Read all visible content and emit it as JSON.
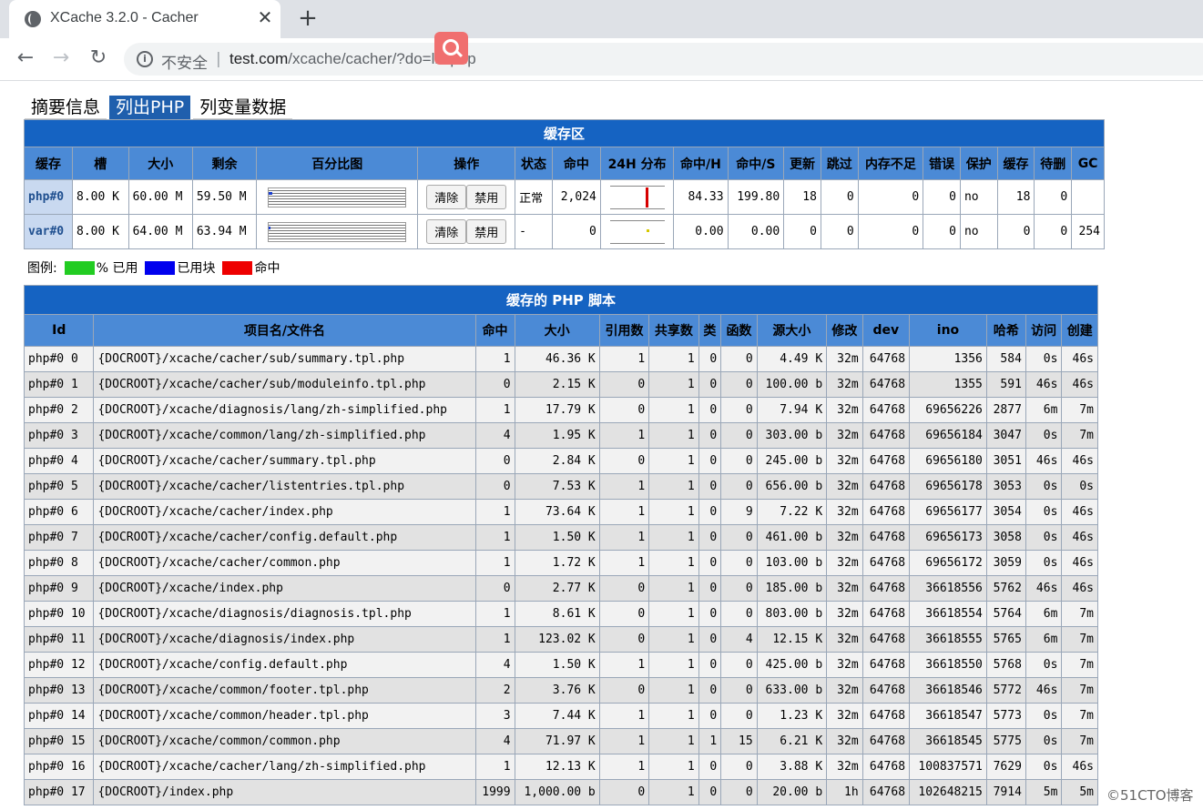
{
  "browser": {
    "tab_title": "XCache 3.2.0 - Cacher",
    "tab_close": "✕",
    "new_tab": "+",
    "insecure_label": "不安全",
    "separator": "|",
    "url_host": "test.com",
    "url_path": "/xcache/cacher/?do=listphp",
    "nav": {
      "back": "←",
      "forward": "→",
      "reload": "↻"
    }
  },
  "page_tabs": [
    "摘要信息",
    "列出PHP",
    "列变量数据"
  ],
  "cache_section": {
    "title": "缓存区",
    "headers": [
      "缓存",
      "槽",
      "大小",
      "剩余",
      "百分比图",
      "操作",
      "状态",
      "命中",
      "24H 分布",
      "命中/H",
      "命中/S",
      "更新",
      "跳过",
      "内存不足",
      "错误",
      "保护",
      "缓存",
      "待删",
      "GC"
    ],
    "clear_label": "清除",
    "disable_label": "禁用",
    "rows": [
      {
        "name": "php#0",
        "slots": "8.00 K",
        "size": "60.00 M",
        "avail": "59.50 M",
        "used_pct": 0.8,
        "status": "正常",
        "hits": "2,024",
        "hits_h": "84.33",
        "hits_s": "199.80",
        "updates": "18",
        "skips": "0",
        "ooms": "0",
        "errors": "0",
        "protected": "no",
        "cached": "18",
        "deleted": "0",
        "gc": ""
      },
      {
        "name": "var#0",
        "slots": "8.00 K",
        "size": "64.00 M",
        "avail": "63.94 M",
        "used_pct": 0.1,
        "status": "-",
        "hits": "0",
        "hits_h": "0.00",
        "hits_s": "0.00",
        "updates": "0",
        "skips": "0",
        "ooms": "0",
        "errors": "0",
        "protected": "no",
        "cached": "0",
        "deleted": "0",
        "gc": "254"
      }
    ]
  },
  "legend": {
    "label": "图例:",
    "items": [
      {
        "text": "% 已用",
        "color": "#22cc22"
      },
      {
        "text": "已用块",
        "color": "#0000ee"
      },
      {
        "text": "命中",
        "color": "#ee0000"
      }
    ]
  },
  "scripts_section": {
    "title": "缓存的 PHP 脚本",
    "headers": [
      "Id",
      "项目名/文件名",
      "命中",
      "大小",
      "引用数",
      "共享数",
      "类",
      "函数",
      "源大小",
      "修改",
      "dev",
      "ino",
      "哈希",
      "访问",
      "创建"
    ],
    "rows": [
      [
        "php#0 0",
        "{DOCROOT}/xcache/cacher/sub/summary.tpl.php",
        "1",
        "46.36 K",
        "1",
        "1",
        "0",
        "0",
        "4.49 K",
        "32m",
        "64768",
        "1356",
        "584",
        "0s",
        "46s"
      ],
      [
        "php#0 1",
        "{DOCROOT}/xcache/cacher/sub/moduleinfo.tpl.php",
        "0",
        "2.15 K",
        "0",
        "1",
        "0",
        "0",
        "100.00 b",
        "32m",
        "64768",
        "1355",
        "591",
        "46s",
        "46s"
      ],
      [
        "php#0 2",
        "{DOCROOT}/xcache/diagnosis/lang/zh-simplified.php",
        "1",
        "17.79 K",
        "0",
        "1",
        "0",
        "0",
        "7.94 K",
        "32m",
        "64768",
        "69656226",
        "2877",
        "6m",
        "7m"
      ],
      [
        "php#0 3",
        "{DOCROOT}/xcache/common/lang/zh-simplified.php",
        "4",
        "1.95 K",
        "1",
        "1",
        "0",
        "0",
        "303.00 b",
        "32m",
        "64768",
        "69656184",
        "3047",
        "0s",
        "7m"
      ],
      [
        "php#0 4",
        "{DOCROOT}/xcache/cacher/summary.tpl.php",
        "0",
        "2.84 K",
        "0",
        "1",
        "0",
        "0",
        "245.00 b",
        "32m",
        "64768",
        "69656180",
        "3051",
        "46s",
        "46s"
      ],
      [
        "php#0 5",
        "{DOCROOT}/xcache/cacher/listentries.tpl.php",
        "0",
        "7.53 K",
        "1",
        "1",
        "0",
        "0",
        "656.00 b",
        "32m",
        "64768",
        "69656178",
        "3053",
        "0s",
        "0s"
      ],
      [
        "php#0 6",
        "{DOCROOT}/xcache/cacher/index.php",
        "1",
        "73.64 K",
        "1",
        "1",
        "0",
        "9",
        "7.22 K",
        "32m",
        "64768",
        "69656177",
        "3054",
        "0s",
        "46s"
      ],
      [
        "php#0 7",
        "{DOCROOT}/xcache/cacher/config.default.php",
        "1",
        "1.50 K",
        "1",
        "1",
        "0",
        "0",
        "461.00 b",
        "32m",
        "64768",
        "69656173",
        "3058",
        "0s",
        "46s"
      ],
      [
        "php#0 8",
        "{DOCROOT}/xcache/cacher/common.php",
        "1",
        "1.72 K",
        "1",
        "1",
        "0",
        "0",
        "103.00 b",
        "32m",
        "64768",
        "69656172",
        "3059",
        "0s",
        "46s"
      ],
      [
        "php#0 9",
        "{DOCROOT}/xcache/index.php",
        "0",
        "2.77 K",
        "0",
        "1",
        "0",
        "0",
        "185.00 b",
        "32m",
        "64768",
        "36618556",
        "5762",
        "46s",
        "46s"
      ],
      [
        "php#0 10",
        "{DOCROOT}/xcache/diagnosis/diagnosis.tpl.php",
        "1",
        "8.61 K",
        "0",
        "1",
        "0",
        "0",
        "803.00 b",
        "32m",
        "64768",
        "36618554",
        "5764",
        "6m",
        "7m"
      ],
      [
        "php#0 11",
        "{DOCROOT}/xcache/diagnosis/index.php",
        "1",
        "123.02 K",
        "0",
        "1",
        "0",
        "4",
        "12.15 K",
        "32m",
        "64768",
        "36618555",
        "5765",
        "6m",
        "7m"
      ],
      [
        "php#0 12",
        "{DOCROOT}/xcache/config.default.php",
        "4",
        "1.50 K",
        "1",
        "1",
        "0",
        "0",
        "425.00 b",
        "32m",
        "64768",
        "36618550",
        "5768",
        "0s",
        "7m"
      ],
      [
        "php#0 13",
        "{DOCROOT}/xcache/common/footer.tpl.php",
        "2",
        "3.76 K",
        "0",
        "1",
        "0",
        "0",
        "633.00 b",
        "32m",
        "64768",
        "36618546",
        "5772",
        "46s",
        "7m"
      ],
      [
        "php#0 14",
        "{DOCROOT}/xcache/common/header.tpl.php",
        "3",
        "7.44 K",
        "1",
        "1",
        "0",
        "0",
        "1.23 K",
        "32m",
        "64768",
        "36618547",
        "5773",
        "0s",
        "7m"
      ],
      [
        "php#0 15",
        "{DOCROOT}/xcache/common/common.php",
        "4",
        "71.97 K",
        "1",
        "1",
        "1",
        "15",
        "6.21 K",
        "32m",
        "64768",
        "36618545",
        "5775",
        "0s",
        "7m"
      ],
      [
        "php#0 16",
        "{DOCROOT}/xcache/cacher/lang/zh-simplified.php",
        "1",
        "12.13 K",
        "1",
        "1",
        "0",
        "0",
        "3.88 K",
        "32m",
        "64768",
        "100837571",
        "7629",
        "0s",
        "46s"
      ],
      [
        "php#0 17",
        "{DOCROOT}/index.php",
        "1999",
        "1,000.00 b",
        "0",
        "1",
        "0",
        "0",
        "20.00 b",
        "1h",
        "64768",
        "102648215",
        "7914",
        "5m",
        "5m"
      ]
    ]
  },
  "watermark": "©51CTO博客"
}
